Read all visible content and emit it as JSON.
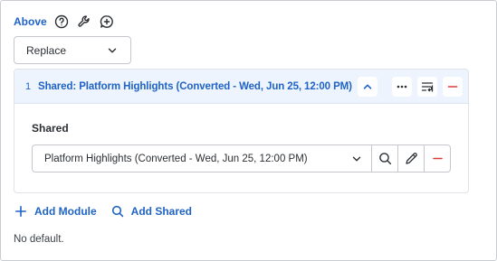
{
  "above": {
    "label": "Above",
    "icons": [
      "help-circle-icon",
      "wrench-icon",
      "comment-plus-icon"
    ]
  },
  "mode_select": {
    "value": "Replace",
    "icon": "chevron-down-icon"
  },
  "module": {
    "index": "1",
    "title": "Shared: Platform Highlights (Converted - Wed, Jun 25, 12:00 PM)",
    "header_buttons": [
      "chevron-up-icon",
      "more-horizontal-icon",
      "wrap-lines-icon",
      "minus-icon"
    ],
    "field_label": "Shared",
    "field_value": "Platform Highlights (Converted - Wed, Jun 25, 12:00 PM)",
    "field_buttons": [
      "search-icon",
      "pencil-icon",
      "minus-icon"
    ]
  },
  "actions": {
    "add_module": "Add Module",
    "add_shared": "Add Shared"
  },
  "footer_text": "No default.",
  "colors": {
    "accent": "#1f63c6",
    "danger": "#d93a3a",
    "header_bg": "#eef4fd"
  }
}
